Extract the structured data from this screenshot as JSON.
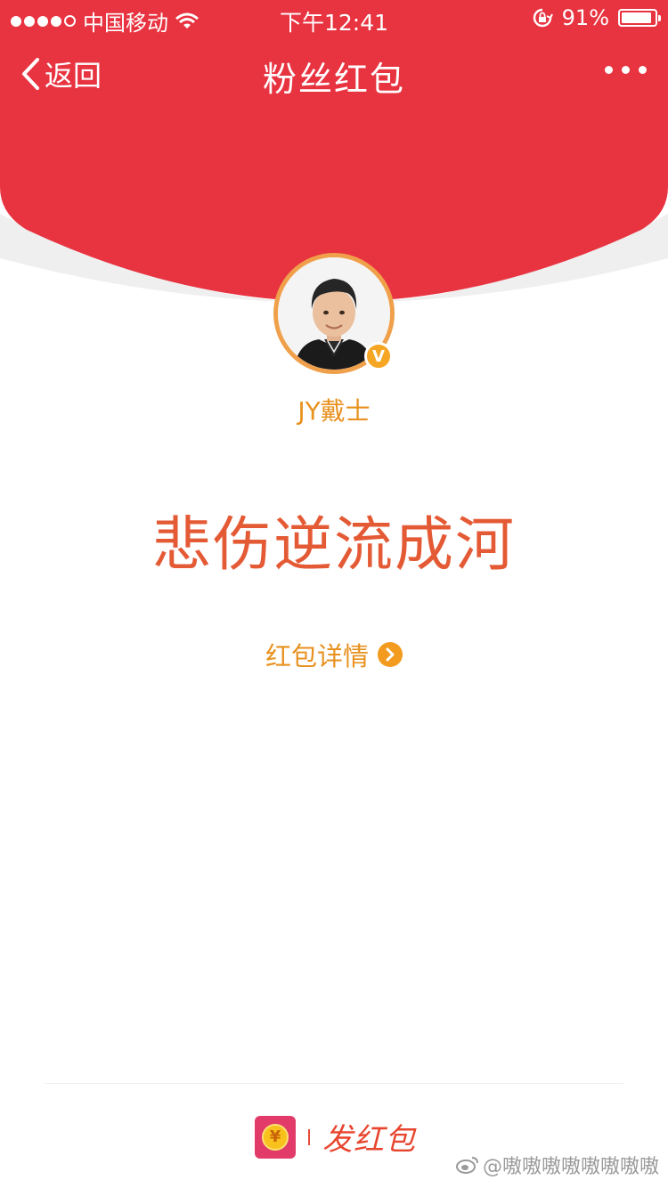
{
  "status_bar": {
    "carrier": "中国移动",
    "time": "下午12:41",
    "battery_text": "91%",
    "battery_level": 0.91
  },
  "nav": {
    "back_label": "返回",
    "title": "粉丝红包"
  },
  "profile": {
    "username": "JY戴士",
    "verified_badge": "V"
  },
  "message": "悲伤逆流成河",
  "details_link": "红包详情",
  "bottom": {
    "send_label": "发红包",
    "coin_symbol": "¥"
  },
  "watermark": "@嗷嗷嗷嗷嗷嗷嗷嗷",
  "colors": {
    "header_red": "#e83340",
    "accent_orange": "#e8911f",
    "message_red": "#e45a35"
  },
  "icons": {
    "back": "chevron-left-icon",
    "more": "more-dots-icon",
    "wifi": "wifi-icon",
    "lock": "rotation-lock-icon",
    "battery": "battery-icon",
    "details": "chevron-right-circle-icon",
    "send": "red-packet-coin-icon",
    "weibo": "weibo-icon"
  }
}
